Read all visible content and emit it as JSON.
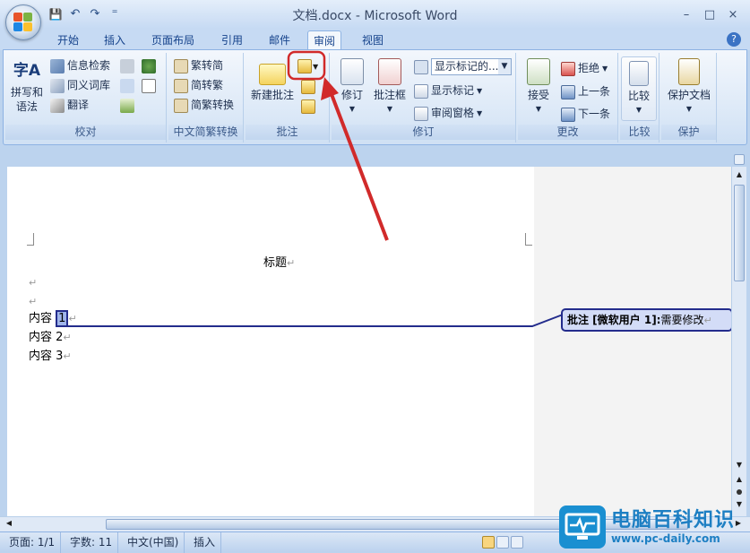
{
  "window": {
    "title": "文档.docx - Microsoft Word",
    "minimize": "–",
    "maximize": "□",
    "close": "×"
  },
  "qat": {
    "save": "💾",
    "undo": "↶",
    "redo": "↷",
    "customize": "⁼"
  },
  "tabs": [
    "开始",
    "插入",
    "页面布局",
    "引用",
    "邮件",
    "审阅",
    "视图"
  ],
  "active_tab": "审阅",
  "help": "?",
  "ribbon": {
    "proofing": {
      "label": "校对",
      "spell": "拼写和语法",
      "spell_glyph": "字A",
      "research": "信息检索",
      "thesaurus": "同义词库",
      "translate": "翻译"
    },
    "chinese": {
      "label": "中文简繁转换",
      "to_simplified": "繁转简",
      "to_traditional": "简转繁",
      "convert": "简繁转换"
    },
    "comments": {
      "label": "批注",
      "new_comment": "新建批注"
    },
    "tracking": {
      "label": "修订",
      "track_changes": "修订",
      "balloons": "批注框",
      "display_select": "显示标记的...",
      "show_markup": "显示标记",
      "reviewing_pane": "审阅窗格"
    },
    "changes": {
      "label": "更改",
      "accept": "接受",
      "reject": "拒绝",
      "previous": "上一条",
      "next": "下一条"
    },
    "compare": {
      "label": "比较",
      "compare": "比较"
    },
    "protect": {
      "label": "保护",
      "protect_doc": "保护文档"
    }
  },
  "document": {
    "title": "标题",
    "lines": [
      "内容",
      "内容 2",
      "内容 3"
    ],
    "selected_char": "1",
    "pilcrow": "↵"
  },
  "comment": {
    "prefix": "批注 [",
    "author": "微软用户 1]:",
    "text": "需要修改",
    "pilcrow": "↵"
  },
  "statusbar": {
    "page": "页面: 1/1",
    "words": "字数: 11",
    "language": "中文(中国)",
    "mode": "插入"
  },
  "watermark": {
    "title": "电脑百科知识",
    "url": "www.pc-daily.com"
  },
  "colors": {
    "accent": "#15428b",
    "arrow": "#d12a2a",
    "comment_border": "#232c8c"
  }
}
